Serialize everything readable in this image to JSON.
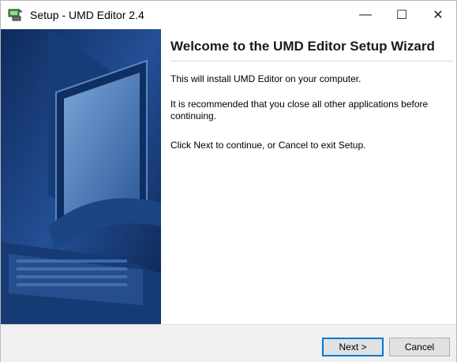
{
  "window": {
    "title": "Setup - UMD Editor 2.4",
    "minimize_symbol": "—",
    "maximize_symbol": "☐",
    "close_symbol": "✕"
  },
  "content": {
    "heading": "Welcome to the UMD Editor Setup Wizard",
    "paragraph_1": "This will install UMD Editor on your computer.",
    "paragraph_2": "It is recommended that you close all other applications before continuing.",
    "paragraph_3": "Click Next to continue, or Cancel to exit Setup."
  },
  "buttons": {
    "next_label": "Next >",
    "cancel_label": "Cancel"
  },
  "colors": {
    "side_panel_dark": "#102f63",
    "side_panel_light": "#4b7fc4",
    "focus_border": "#0078d7"
  },
  "icons": {
    "app": "setup-installer-icon",
    "side_panel": "monitor-and-keyboard-illustration"
  }
}
